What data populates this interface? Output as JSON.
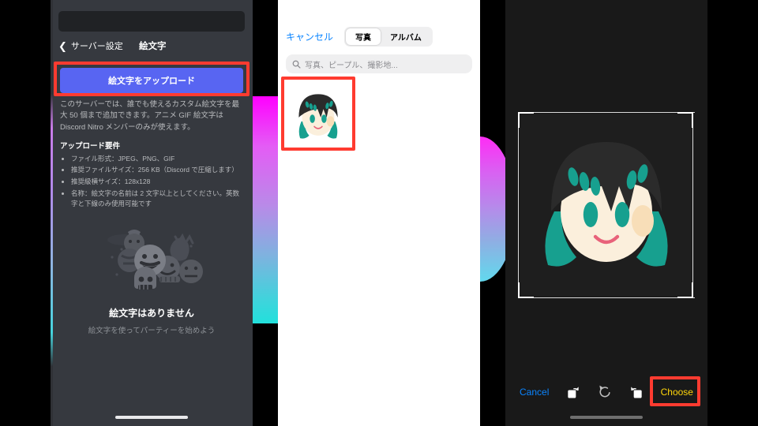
{
  "left_panel": {
    "back_label": "サーバー設定",
    "back_icon": "chevron-left-icon",
    "title": "絵文字",
    "upload_button_label": "絵文字をアップロード",
    "description": "このサーバーでは、誰でも使えるカスタム絵文字を最大 50 個まで追加できます。アニメ GIF 絵文字は Discord Nitro メンバーのみが使えます。",
    "requirements_title": "アップロード要件",
    "requirements": [
      "ファイル形式：JPEG、PNG、GIF",
      "推奨ファイルサイズ：256 KB（Discord で圧縮します）",
      "推奨級横サイズ：128x128",
      "名称：絵文字の名前は 2 文字以上としてください。英数字と下線のみ使用可能です"
    ],
    "empty_title": "絵文字はありません",
    "empty_subtitle": "絵文字を使ってパーティーを始めよう",
    "accent_color": "#5865F2"
  },
  "mid_panel": {
    "cancel_label": "キャンセル",
    "segments": [
      {
        "label": "写真",
        "active": true
      },
      {
        "label": "アルバム",
        "active": false
      }
    ],
    "search_placeholder": "写真、ピープル、撮影地...",
    "search_icon": "search-icon",
    "search_value": "",
    "thumbnail_name": "photo-thumbnail-avatar",
    "cancel_color": "#0A84FF"
  },
  "right_panel": {
    "cancel_label": "Cancel",
    "choose_label": "Choose",
    "tool_icons": [
      "rotate-right-icon",
      "reset-rotation-icon",
      "rotate-left-icon"
    ],
    "cancel_color": "#0A84FF",
    "choose_color": "#FFD60A"
  },
  "annotations": {
    "highlight_color": "#FF3B30",
    "highlighted": [
      "upload-emoji-button",
      "photo-thumbnail-avatar",
      "choose-button"
    ]
  }
}
